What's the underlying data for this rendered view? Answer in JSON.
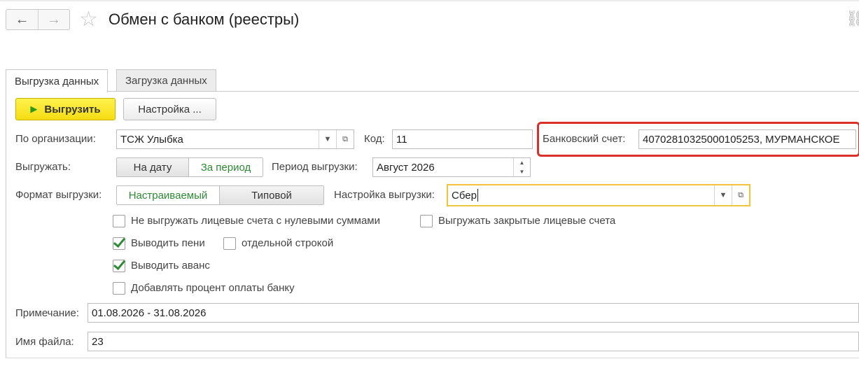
{
  "window": {
    "title": "Обмен с банком (реестры)"
  },
  "nav": {
    "back_icon": "←",
    "forward_icon": "→",
    "star_icon": "☆",
    "link_icon": "⛓"
  },
  "tabs": [
    {
      "label": "Выгрузка данных",
      "active": true
    },
    {
      "label": "Загрузка данных",
      "active": false
    }
  ],
  "toolbar": {
    "export_label": "Выгрузить",
    "settings_label": "Настройка ..."
  },
  "form": {
    "organization_label": "По организации:",
    "organization_value": "ТСЖ Улыбка",
    "code_label": "Код:",
    "code_value": "11",
    "bank_account_label": "Банковский счет:",
    "bank_account_value": "40702810325000105253, МУРМАНСКОЕ",
    "export_mode_label": "Выгружать:",
    "export_mode_options": [
      "На дату",
      "За период"
    ],
    "export_mode_selected": "За период",
    "period_label": "Период выгрузки:",
    "period_value": "Август 2026",
    "format_label": "Формат выгрузки:",
    "format_options": [
      "Настраиваемый",
      "Типовой"
    ],
    "format_selected": "Настраиваемый",
    "export_setting_label": "Настройка выгрузки:",
    "export_setting_value": "Сбер",
    "checkboxes": [
      {
        "label": "Не выгружать лицевые счета с нулевыми суммами",
        "checked": false
      },
      {
        "label": "Выгружать закрытые лицевые счета",
        "checked": false
      },
      {
        "label": "Выводить пени",
        "checked": true
      },
      {
        "label": "отдельной строкой",
        "checked": false
      },
      {
        "label": "Выводить аванс",
        "checked": true
      },
      {
        "label": "Добавлять процент оплаты банку",
        "checked": false
      }
    ],
    "note_label": "Примечание:",
    "note_value": "01.08.2026 - 31.08.2026",
    "filename_label": "Имя файла:",
    "filename_value": "23"
  },
  "colors": {
    "highlight": "#d9302a",
    "primary_button": "#f5dc12",
    "check": "#2d8a34",
    "focus_border": "#f0c53a"
  }
}
